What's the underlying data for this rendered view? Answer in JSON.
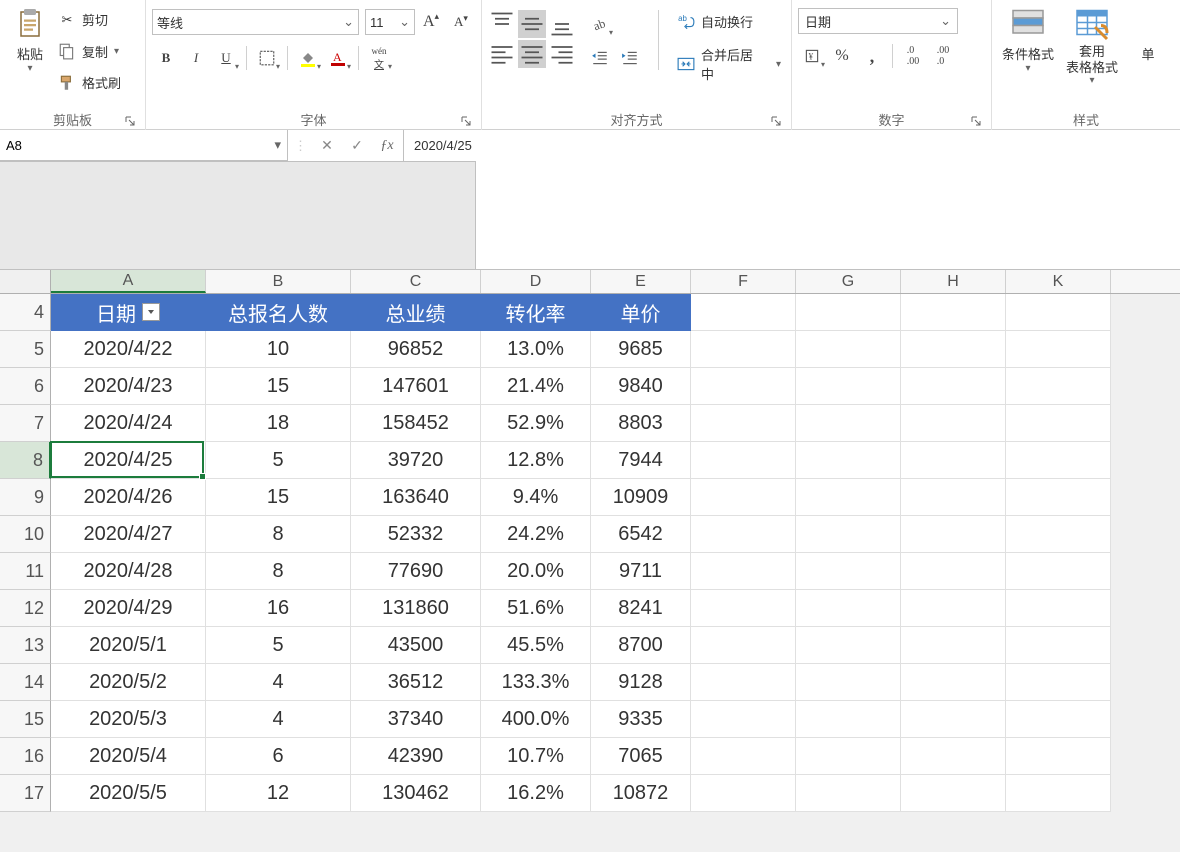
{
  "ribbon": {
    "clipboard": {
      "label": "剪贴板",
      "paste": "粘贴",
      "cut": "剪切",
      "copy": "复制",
      "format_painter": "格式刷"
    },
    "font": {
      "label": "字体",
      "font_name": "等线",
      "font_size": "11",
      "bold": "B",
      "italic": "I",
      "underline": "U",
      "phonetic": "wén"
    },
    "alignment": {
      "label": "对齐方式",
      "wrap_text": "自动换行",
      "merge_center": "合并后居中"
    },
    "number": {
      "label": "数字",
      "format": "日期"
    },
    "styles": {
      "label": "样式",
      "conditional_format": "条件格式",
      "format_as_table": "套用\n表格格式",
      "cell_styles_partial": "单"
    }
  },
  "name_box": "A8",
  "formula_value": "2020/4/25",
  "columns": [
    "A",
    "B",
    "C",
    "D",
    "E",
    "F",
    "G",
    "H",
    "K"
  ],
  "visible_row_start": 4,
  "selected_cell": {
    "row": 8,
    "col": "A"
  },
  "table": {
    "headers": {
      "date": "日期",
      "signups": "总报名人数",
      "revenue": "总业绩",
      "conversion": "转化率",
      "unit_price": "单价"
    },
    "rows": [
      {
        "date": "2020/4/22",
        "signups": "10",
        "revenue": "96852",
        "conversion": "13.0%",
        "unit_price": "9685"
      },
      {
        "date": "2020/4/23",
        "signups": "15",
        "revenue": "147601",
        "conversion": "21.4%",
        "unit_price": "9840"
      },
      {
        "date": "2020/4/24",
        "signups": "18",
        "revenue": "158452",
        "conversion": "52.9%",
        "unit_price": "8803"
      },
      {
        "date": "2020/4/25",
        "signups": "5",
        "revenue": "39720",
        "conversion": "12.8%",
        "unit_price": "7944"
      },
      {
        "date": "2020/4/26",
        "signups": "15",
        "revenue": "163640",
        "conversion": "9.4%",
        "unit_price": "10909"
      },
      {
        "date": "2020/4/27",
        "signups": "8",
        "revenue": "52332",
        "conversion": "24.2%",
        "unit_price": "6542"
      },
      {
        "date": "2020/4/28",
        "signups": "8",
        "revenue": "77690",
        "conversion": "20.0%",
        "unit_price": "9711"
      },
      {
        "date": "2020/4/29",
        "signups": "16",
        "revenue": "131860",
        "conversion": "51.6%",
        "unit_price": "8241"
      },
      {
        "date": "2020/5/1",
        "signups": "5",
        "revenue": "43500",
        "conversion": "45.5%",
        "unit_price": "8700"
      },
      {
        "date": "2020/5/2",
        "signups": "4",
        "revenue": "36512",
        "conversion": "133.3%",
        "unit_price": "9128"
      },
      {
        "date": "2020/5/3",
        "signups": "4",
        "revenue": "37340",
        "conversion": "400.0%",
        "unit_price": "9335"
      },
      {
        "date": "2020/5/4",
        "signups": "6",
        "revenue": "42390",
        "conversion": "10.7%",
        "unit_price": "7065"
      },
      {
        "date": "2020/5/5",
        "signups": "12",
        "revenue": "130462",
        "conversion": "16.2%",
        "unit_price": "10872"
      }
    ]
  }
}
